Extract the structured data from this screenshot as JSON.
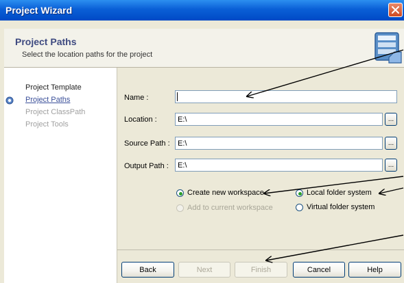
{
  "window": {
    "title": "Project Wizard"
  },
  "header": {
    "title": "Project Paths",
    "subtitle": "Select the location paths for the project"
  },
  "nav": {
    "items": [
      {
        "label": "Project Template",
        "state": "done"
      },
      {
        "label": "Project Paths",
        "state": "active"
      },
      {
        "label": "Project ClassPath",
        "state": "disabled"
      },
      {
        "label": "Project Tools",
        "state": "disabled"
      }
    ]
  },
  "form": {
    "name": {
      "label": "Name :",
      "value": ""
    },
    "location": {
      "label": "Location :",
      "value": "E:\\",
      "browse_label": "..."
    },
    "source_path": {
      "label": "Source Path :",
      "value": "E:\\",
      "browse_label": "..."
    },
    "output_path": {
      "label": "Output Path :",
      "value": "E:\\",
      "browse_label": "..."
    }
  },
  "workspace_options": {
    "create_new": {
      "label": "Create new workspace",
      "checked": true,
      "enabled": true
    },
    "add_current": {
      "label": "Add to current workspace",
      "checked": false,
      "enabled": false
    }
  },
  "folder_options": {
    "local": {
      "label": "Local folder system",
      "checked": true
    },
    "virtual": {
      "label": "Virtual folder system",
      "checked": false
    }
  },
  "buttons": {
    "back": {
      "label": "Back",
      "enabled": true
    },
    "next": {
      "label": "Next",
      "enabled": false
    },
    "finish": {
      "label": "Finish",
      "enabled": false
    },
    "cancel": {
      "label": "Cancel",
      "enabled": true
    },
    "help": {
      "label": "Help",
      "enabled": true
    }
  },
  "colors": {
    "titlebar": "#0a5fd6",
    "header_title": "#3e4a80",
    "active_nav": "#3a4f99",
    "radio_checked": "#2a9d2a",
    "close_button": "#cf4a22"
  }
}
